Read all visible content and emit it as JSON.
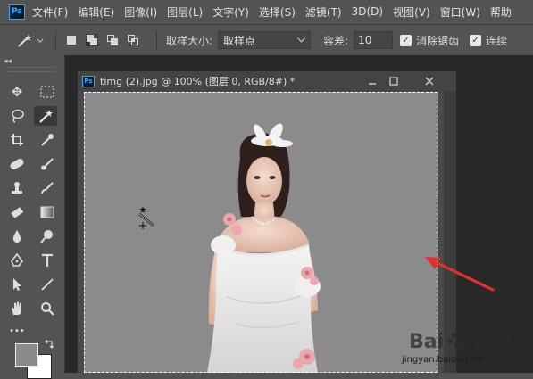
{
  "app": {
    "logo": "Ps"
  },
  "menu": [
    "文件(F)",
    "编辑(E)",
    "图像(I)",
    "图层(L)",
    "文字(Y)",
    "选择(S)",
    "滤镜(T)",
    "3D(D)",
    "视图(V)",
    "窗口(W)",
    "帮助"
  ],
  "options": {
    "sample_size_label": "取样大小:",
    "sample_size_value": "取样点",
    "tolerance_label": "容差:",
    "tolerance_value": "10",
    "antialias_label": "消除锯齿",
    "contiguous_label": "连续",
    "antialias_checked": true,
    "contiguous_checked": true
  },
  "document": {
    "title": "timg (2).jpg @ 100% (图层 0, RGB/8#) *"
  },
  "toolbar": {
    "collapse": "◂◂",
    "more": "•••"
  },
  "watermark": {
    "brand": "Bai 经验",
    "url": "jingyan.baidu.com"
  },
  "colors": {
    "menubar_bg": "#535353",
    "canvas_bg": "#8a8a8a",
    "arrow": "#e03030",
    "ps_blue": "#31a8ff"
  }
}
